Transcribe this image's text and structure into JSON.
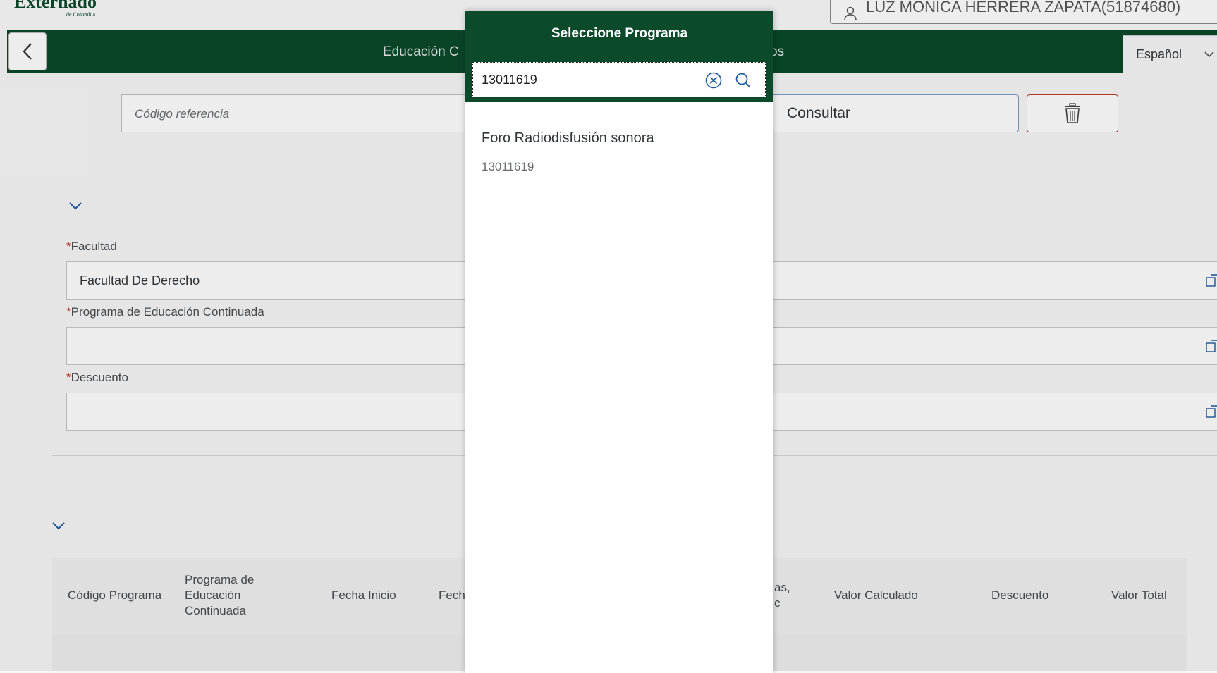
{
  "header": {
    "logo": "Externado",
    "logo_sub": "de Colombia",
    "user": "LUZ MONICA HERRERA ZAPATA(51874680)",
    "title_left": "Educación C",
    "title_right": "os",
    "language": "Español"
  },
  "filters": {
    "ref_placeholder": "Código referencia",
    "consultar_label": "Consultar"
  },
  "form": {
    "facultad_label": "Facultad",
    "facultad_value": "Facultad De Derecho",
    "programa_label": "Programa de Educación Continuada",
    "programa_value": "",
    "descuento_label": "Descuento",
    "descuento_value": ""
  },
  "table": {
    "col_codigo": "Código Programa",
    "col_programa_1": "Programa de",
    "col_programa_2": "Educación",
    "col_programa_3": "Continuada",
    "col_fecha_inicio": "Fecha Inicio",
    "col_fecha_fin": "Fech",
    "col_partial_1": "as,",
    "col_partial_2": "c",
    "col_valor_calculado": "Valor Calculado",
    "col_descuento": "Descuento",
    "col_valor_total": "Valor Total"
  },
  "dialog": {
    "title": "Seleccione Programa",
    "search_value": "13011619",
    "items": [
      {
        "title": "Foro Radiodisfusión sonora",
        "description": "13011619"
      }
    ]
  },
  "colors": {
    "brand_green": "#0b4a2b",
    "danger": "#c0392b"
  }
}
